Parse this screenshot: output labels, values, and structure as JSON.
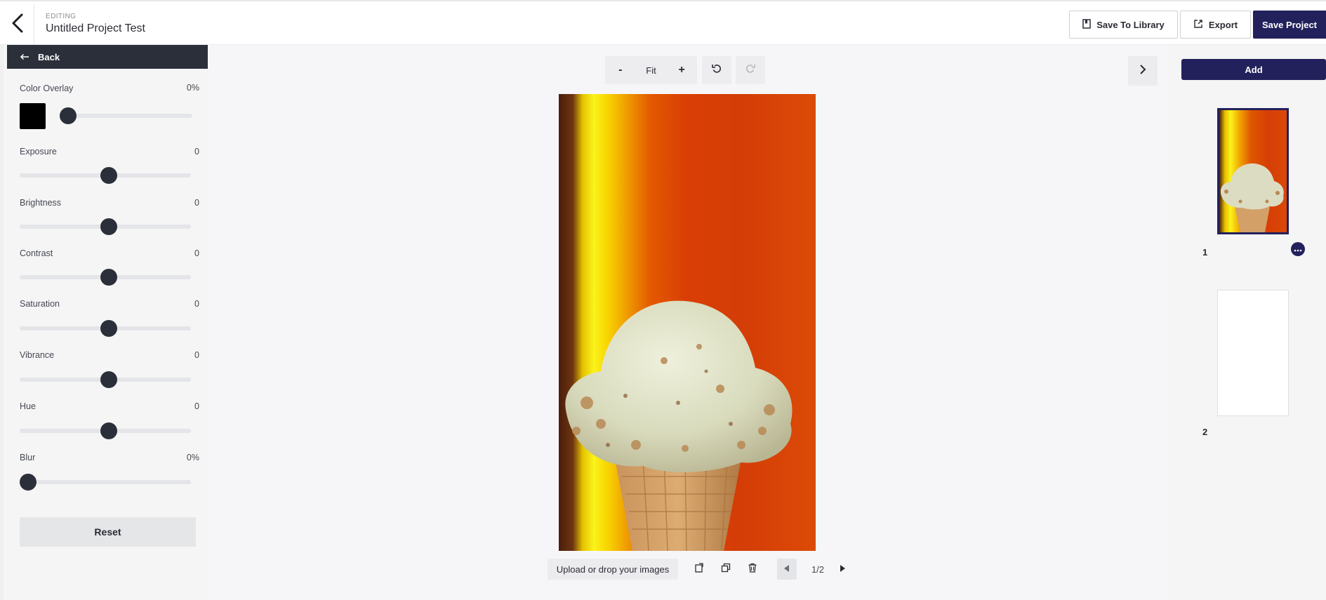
{
  "header": {
    "editing_label": "EDITING",
    "project_title": "Untitled Project Test",
    "save_to_library_label": "Save To Library",
    "export_label": "Export",
    "save_project_label": "Save Project"
  },
  "left_panel": {
    "back_label": "Back",
    "color_overlay": {
      "label": "Color Overlay",
      "value": "0%",
      "swatch_color": "#000000",
      "level": 0
    },
    "adjustments": [
      {
        "label": "Exposure",
        "value": "0"
      },
      {
        "label": "Brightness",
        "value": "0"
      },
      {
        "label": "Contrast",
        "value": "0"
      },
      {
        "label": "Saturation",
        "value": "0"
      },
      {
        "label": "Vibrance",
        "value": "0"
      },
      {
        "label": "Hue",
        "value": "0"
      }
    ],
    "blur": {
      "label": "Blur",
      "value": "0%",
      "level": 0
    },
    "reset_label": "Reset"
  },
  "canvas": {
    "zoom_out_label": "-",
    "zoom_fit_label": "Fit",
    "zoom_in_label": "+",
    "upload_label": "Upload or drop your images",
    "pager_text": "1/2",
    "photo_subject": "ice-cream-cone"
  },
  "right_panel": {
    "add_label": "Add",
    "pages": [
      {
        "number": "1",
        "selected": true
      },
      {
        "number": "2",
        "selected": false
      }
    ]
  },
  "colors": {
    "brand_navy": "#23215c",
    "panel_dark": "#2b2f3a",
    "slider_track": "#e4e5e8"
  },
  "icons": {
    "back_chevron": "chevron-left-icon",
    "library": "bookmark-icon",
    "export": "share-icon",
    "undo": "undo-icon",
    "redo": "redo-icon",
    "next_panel": "chevron-right-icon",
    "replace": "replace-image-icon",
    "duplicate": "duplicate-icon",
    "delete": "trash-icon",
    "prev_page": "triangle-left-icon",
    "next_page": "triangle-right-icon",
    "more": "ellipsis-icon"
  }
}
